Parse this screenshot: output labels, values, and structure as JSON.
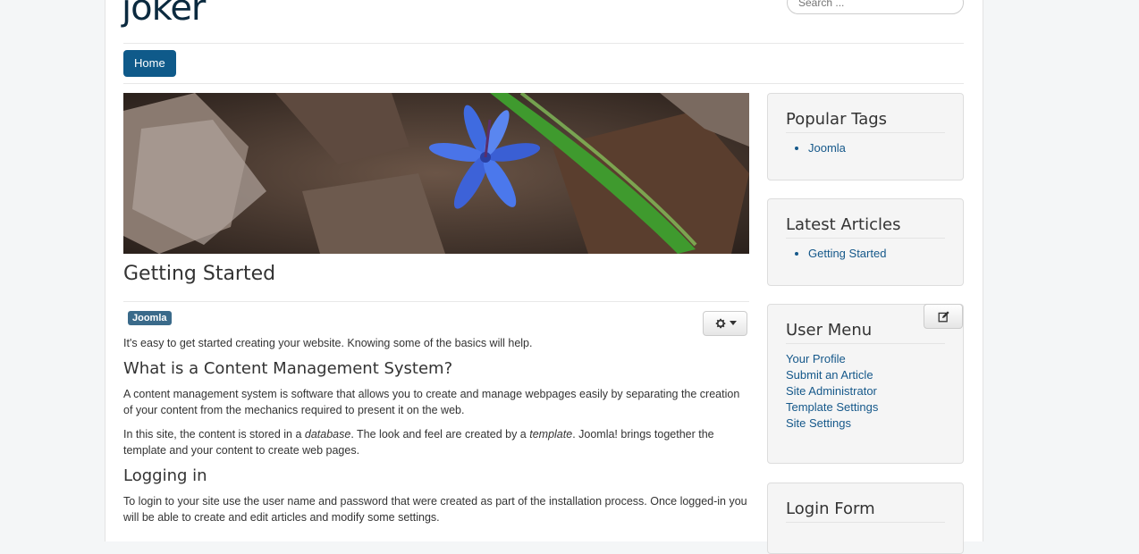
{
  "site": {
    "title": "joker"
  },
  "search": {
    "placeholder": "Search ..."
  },
  "nav": {
    "home": "Home"
  },
  "article": {
    "title": "Getting Started",
    "tag": "Joomla",
    "intro": "It's easy to get started creating your website. Knowing some of the basics will help.",
    "h_cms": "What is a Content Management System?",
    "p_cms": "A content management system is software that allows you to create and manage webpages easily by separating the creation of your content from the mechanics required to present it on the web.",
    "p_site_a": "In this site, the content is stored in a ",
    "p_site_db": "database",
    "p_site_b": ". The look and feel are created by a ",
    "p_site_tpl": "template",
    "p_site_c": ". Joomla! brings together the template and your content to create web pages.",
    "h_login": "Logging in",
    "p_login": "To login to your site use the user name and password that were created as part of the installation process. Once logged-in you will be able to create and edit articles and modify some settings."
  },
  "sidebar": {
    "popular_tags": {
      "title": "Popular Tags",
      "items": [
        "Joomla"
      ]
    },
    "latest_articles": {
      "title": "Latest Articles",
      "items": [
        "Getting Started"
      ]
    },
    "user_menu": {
      "title": "User Menu",
      "items": [
        "Your Profile",
        "Submit an Article",
        "Site Administrator",
        "Template Settings",
        "Site Settings"
      ]
    },
    "login_form": {
      "title": "Login Form"
    }
  },
  "icons": {
    "gear": "gear-icon",
    "edit": "edit-icon",
    "caret": "caret-down-icon"
  },
  "colors": {
    "accent": "#0f5a8a",
    "link": "#15588a"
  }
}
